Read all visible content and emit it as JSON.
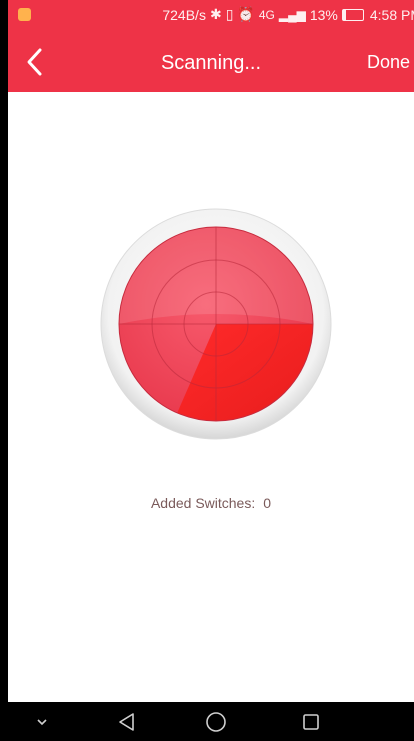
{
  "status_bar": {
    "speed": "724B/s",
    "network": "4G",
    "battery_percent": "13%",
    "time": "4:58 PM",
    "icons": [
      "bluetooth-icon",
      "vibrate-icon",
      "alarm-icon",
      "signal-icon",
      "battery-icon"
    ]
  },
  "header": {
    "title": "Scanning...",
    "done_label": "Done",
    "back_icon": "chevron-left-icon",
    "background": "#ee3347"
  },
  "scan": {
    "added_label": "Added Switches:",
    "added_count": "0",
    "radar_color": "#ee3347"
  },
  "nav_bar": {
    "icons": [
      "chevron-down-icon",
      "back-triangle-icon",
      "home-circle-icon",
      "recents-square-icon"
    ]
  }
}
